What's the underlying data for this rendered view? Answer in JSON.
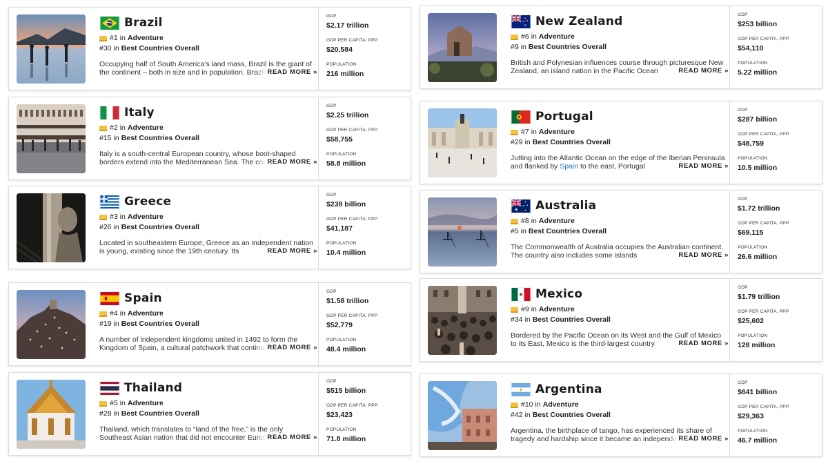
{
  "labels": {
    "gdp": "GDP",
    "gdp_per_capita": "GDP PER CAPITA, PPP",
    "population": "POPULATION",
    "in": "in",
    "best_overall": "Best Countries Overall",
    "read_more": "READ MORE »"
  },
  "countries": [
    {
      "name": "Brazil",
      "category_rank": "#1",
      "category": "Adventure",
      "overall_rank": "#30",
      "description": "Occupying half of South America's land mass, Brazil is the giant of the continent – both in size and in population. Brazil",
      "gdp": "$2.17 trillion",
      "gdp_per_capita": "$20,584",
      "population": "216 million"
    },
    {
      "name": "Italy",
      "category_rank": "#2",
      "category": "Adventure",
      "overall_rank": "#15",
      "description": "Italy is a south-central European country, whose boot-shaped borders extend into the Mediterranean Sea. The country",
      "gdp": "$2.25 trillion",
      "gdp_per_capita": "$58,755",
      "population": "58.8 million"
    },
    {
      "name": "Greece",
      "category_rank": "#3",
      "category": "Adventure",
      "overall_rank": "#26",
      "description": "Located in southeastern Europe, Greece as an independent nation is young, existing since the 19th century. Its",
      "gdp": "$238 billion",
      "gdp_per_capita": "$41,187",
      "population": "10.4 million"
    },
    {
      "name": "Spain",
      "category_rank": "#4",
      "category": "Adventure",
      "overall_rank": "#19",
      "description": "A number of independent kingdoms united in 1492 to form the Kingdom of Spain, a cultural patchwork that continues",
      "gdp": "$1.58 trillion",
      "gdp_per_capita": "$52,779",
      "population": "48.4 million"
    },
    {
      "name": "Thailand",
      "category_rank": "#5",
      "category": "Adventure",
      "overall_rank": "#28",
      "description": "Thailand, which translates to “land of the free,” is the only Southeast Asian nation that did not encounter European",
      "gdp": "$515 billion",
      "gdp_per_capita": "$23,423",
      "population": "71.8 million"
    },
    {
      "name": "New Zealand",
      "category_rank": "#6",
      "category": "Adventure",
      "overall_rank": "#9",
      "description": "British and Polynesian influences course through picturesque New Zealand, an island nation in the Pacific Ocean",
      "gdp": "$253 billion",
      "gdp_per_capita": "$54,110",
      "population": "5.22 million"
    },
    {
      "name": "Portugal",
      "category_rank": "#7",
      "category": "Adventure",
      "overall_rank": "#29",
      "description_before": "Jutting into the Atlantic Ocean on the edge of the Iberian Peninsula and flanked by ",
      "description_link": "Spain",
      "description_after": " to the east, Portugal",
      "gdp": "$287 billion",
      "gdp_per_capita": "$48,759",
      "population": "10.5 million"
    },
    {
      "name": "Australia",
      "category_rank": "#8",
      "category": "Adventure",
      "overall_rank": "#5",
      "description": "The Commonwealth of Australia occupies the Australian continent. The country also includes some islands",
      "gdp": "$1.72 trillion",
      "gdp_per_capita": "$69,115",
      "population": "26.6 million"
    },
    {
      "name": "Mexico",
      "category_rank": "#9",
      "category": "Adventure",
      "overall_rank": "#34",
      "description": "Bordered by the Pacific Ocean on its West and the Gulf of Mexico to its East, Mexico is the third-largest country",
      "gdp": "$1.79 trillion",
      "gdp_per_capita": "$25,602",
      "population": "128 million"
    },
    {
      "name": "Argentina",
      "category_rank": "#10",
      "category": "Adventure",
      "overall_rank": "#42",
      "description": "Argentina, the birthplace of tango, has experienced its share of tragedy and hardship since it became an independent",
      "gdp": "$641 billion",
      "gdp_per_capita": "$29,363",
      "population": "46.7 million"
    }
  ]
}
